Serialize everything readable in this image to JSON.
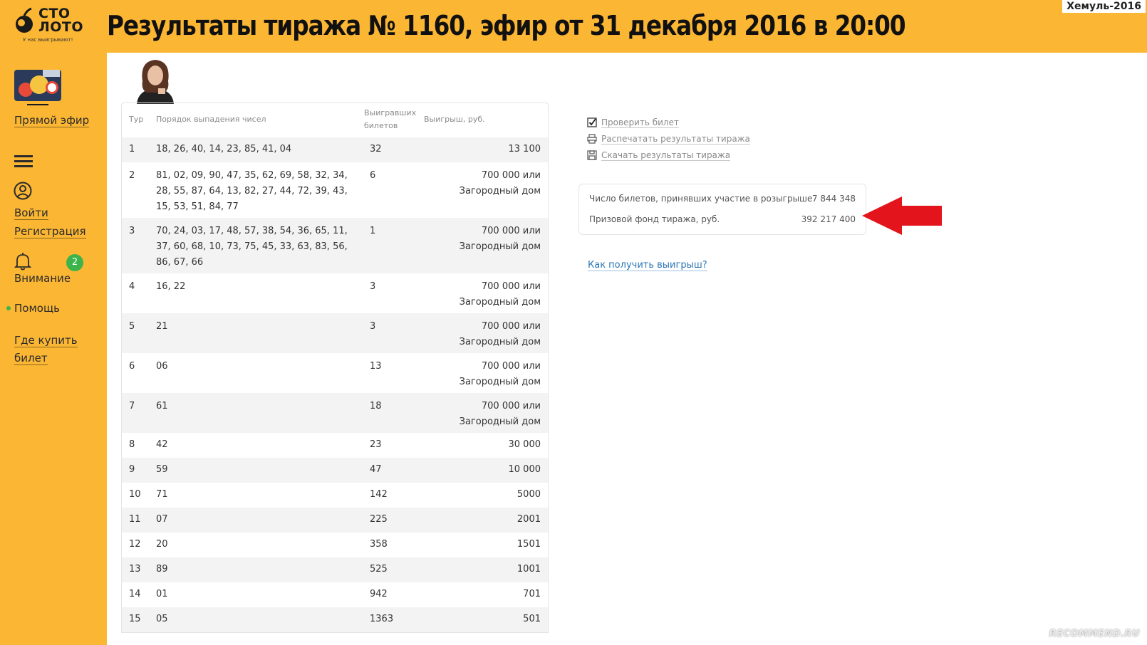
{
  "logo": {
    "line1": "СТО",
    "line2": "ЛОТО",
    "tagline": "У нас выигрывают!"
  },
  "header": {
    "title": "Результаты тиража № 1160, эфир от 31 декабря 2016 в 20:00"
  },
  "watermarks": {
    "top": "Хемуль-2016",
    "bottom": "RECOMMEND.RU"
  },
  "sidebar": {
    "live": "Прямой эфир",
    "login": "Войти",
    "register": "Регистрация",
    "attention": "Внимание",
    "attention_count": "2",
    "help": "Помощь",
    "where_buy_1": "Где купить",
    "where_buy_2": "билет"
  },
  "table": {
    "headers": {
      "round": "Тур",
      "numbers": "Порядок выпадения чисел",
      "winners_1": "Выигравших",
      "winners_2": "билетов",
      "prize": "Выигрыш, руб."
    },
    "rows": [
      {
        "round": "1",
        "numbers": "18, 26, 40, 14, 23, 85, 41, 04",
        "winners": "32",
        "prize": "13 100"
      },
      {
        "round": "2",
        "numbers": "81, 02, 09, 90, 47, 35, 62, 69, 58, 32, 34, 28, 55, 87, 64, 13, 82, 27, 44, 72, 39, 43, 15, 53, 51, 84, 77",
        "winners": "6",
        "prize": "700 000 или Загородный дом"
      },
      {
        "round": "3",
        "numbers": "70, 24, 03, 17, 48, 57, 38, 54, 36, 65, 11, 37, 60, 68, 10, 73, 75, 45, 33, 63, 83, 56, 86, 67, 66",
        "winners": "1",
        "prize": "700 000 или Загородный дом"
      },
      {
        "round": "4",
        "numbers": "16, 22",
        "winners": "3",
        "prize": "700 000 или Загородный дом"
      },
      {
        "round": "5",
        "numbers": "21",
        "winners": "3",
        "prize": "700 000 или Загородный дом"
      },
      {
        "round": "6",
        "numbers": "06",
        "winners": "13",
        "prize": "700 000 или Загородный дом"
      },
      {
        "round": "7",
        "numbers": "61",
        "winners": "18",
        "prize": "700 000 или Загородный дом"
      },
      {
        "round": "8",
        "numbers": "42",
        "winners": "23",
        "prize": "30 000"
      },
      {
        "round": "9",
        "numbers": "59",
        "winners": "47",
        "prize": "10 000"
      },
      {
        "round": "10",
        "numbers": "71",
        "winners": "142",
        "prize": "5000"
      },
      {
        "round": "11",
        "numbers": "07",
        "winners": "225",
        "prize": "2001"
      },
      {
        "round": "12",
        "numbers": "20",
        "winners": "358",
        "prize": "1501"
      },
      {
        "round": "13",
        "numbers": "89",
        "winners": "525",
        "prize": "1001"
      },
      {
        "round": "14",
        "numbers": "01",
        "winners": "942",
        "prize": "701"
      },
      {
        "round": "15",
        "numbers": "05",
        "winners": "1363",
        "prize": "501"
      }
    ]
  },
  "actions": {
    "check": "Проверить билет",
    "print": "Распечатать результаты тиража",
    "download": "Скачать результаты тиража"
  },
  "stats": {
    "tickets_label": "Число билетов, принявших участие в розыгрыше",
    "tickets_value": "7 844 348",
    "fund_label": "Призовой фонд тиража, руб.",
    "fund_value": "392 217 400"
  },
  "how_to_get": "Как получить выигрыш?",
  "colors": {
    "brand_yellow": "#fbb634",
    "link_blue": "#2a76b5",
    "arrow_red": "#e3141b",
    "badge_green": "#3cb44b"
  }
}
